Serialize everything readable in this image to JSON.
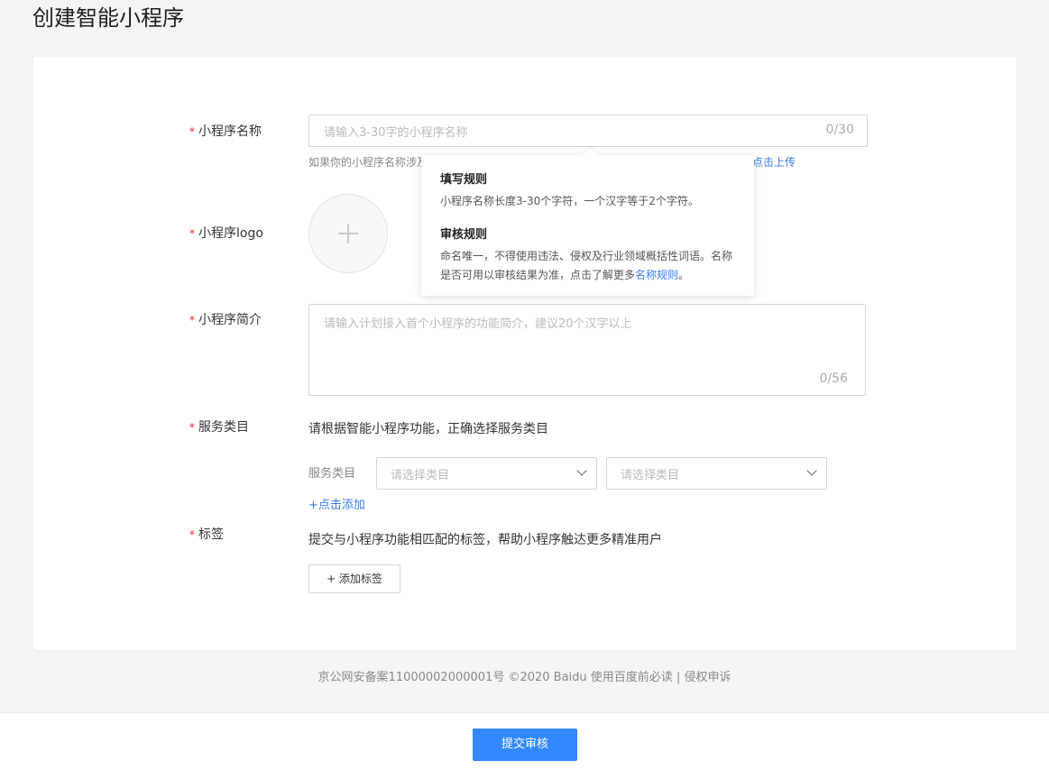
{
  "page_title": "创建智能小程序",
  "form": {
    "name": {
      "label": "小程序名称",
      "placeholder": "请输入3-30字的小程序名称",
      "counter": "0/30",
      "hint_visible": "如果你的小程序名称涉及",
      "hint_link": "点击上传"
    },
    "logo": {
      "label": "小程序logo"
    },
    "intro": {
      "label": "小程序简介",
      "placeholder": "请输入计划接入首个小程序的功能简介，建议20个汉字以上",
      "counter": "0/56"
    },
    "category": {
      "label": "服务类目",
      "description": "请根据智能小程序功能，正确选择服务类目",
      "row_label": "服务类目",
      "select1_placeholder": "请选择类目",
      "select2_placeholder": "请选择类目",
      "add_link": "+点击添加"
    },
    "tags": {
      "label": "标签",
      "description": "提交与小程序功能相匹配的标签，帮助小程序触达更多精准用户",
      "add_button": "+ 添加标签"
    },
    "required_mark": "*"
  },
  "popover": {
    "title1": "填写规则",
    "text1": "小程序名称长度3-30个字符，一个汉字等于2个字符。",
    "title2": "审核规则",
    "text2_before": "命名唯一，不得使用违法、侵权及行业领域概括性词语。名称是否可用以审核结果为准，点击了解更多",
    "text2_link": "名称规则",
    "text2_after": "。"
  },
  "footer": {
    "text": "京公网安备案11000002000001号 ©2020 Baidu 使用百度前必读 | 侵权申诉"
  },
  "submit_button": "提交审核",
  "colors": {
    "accent": "#3388ff",
    "link": "#3b7cf0",
    "required": "#f5222d"
  }
}
